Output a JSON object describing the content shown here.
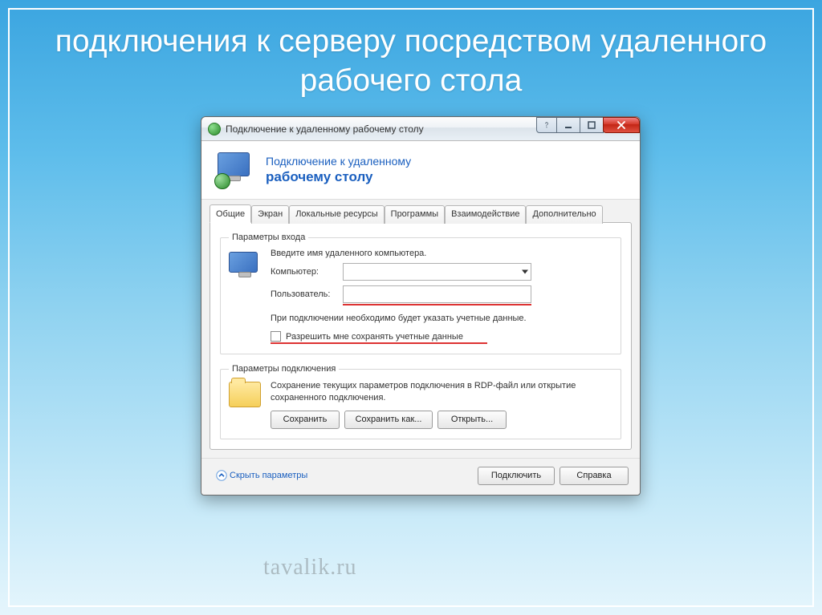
{
  "slide": {
    "title": "подключения к серверу посредством удаленного рабочего стола",
    "watermark": "tavalik.ru"
  },
  "window": {
    "title": "Подключение к удаленному рабочему столу",
    "banner": {
      "line1": "Подключение к удаленному",
      "line2": "рабочему столу"
    },
    "tabs": [
      "Общие",
      "Экран",
      "Локальные ресурсы",
      "Программы",
      "Взаимодействие",
      "Дополнительно"
    ],
    "active_tab": 0,
    "login_group": {
      "legend": "Параметры входа",
      "hint": "Введите имя удаленного компьютера.",
      "computer_label": "Компьютер:",
      "computer_value": "",
      "user_label": "Пользователь:",
      "user_value": "",
      "note": "При подключении необходимо будет указать учетные данные.",
      "save_creds_label": "Разрешить мне сохранять учетные данные"
    },
    "conn_group": {
      "legend": "Параметры подключения",
      "desc": "Сохранение текущих параметров подключения в RDP-файл или открытие сохраненного подключения.",
      "save": "Сохранить",
      "save_as": "Сохранить как...",
      "open": "Открыть..."
    },
    "footer": {
      "hide_params": "Скрыть параметры",
      "connect": "Подключить",
      "help": "Справка"
    }
  }
}
